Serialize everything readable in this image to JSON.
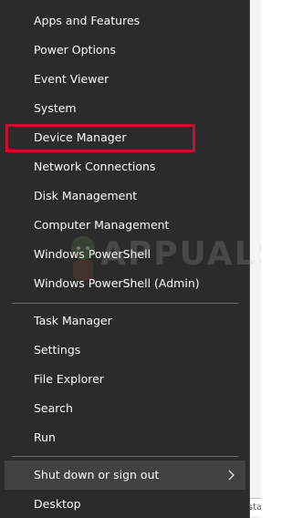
{
  "menu": {
    "items": [
      {
        "label": "Apps and Features"
      },
      {
        "label": "Power Options"
      },
      {
        "label": "Event Viewer"
      },
      {
        "label": "System"
      },
      {
        "label": "Device Manager"
      },
      {
        "label": "Network Connections"
      },
      {
        "label": "Disk Management"
      },
      {
        "label": "Computer Management"
      },
      {
        "label": "Windows PowerShell"
      },
      {
        "label": "Windows PowerShell (Admin)"
      },
      {
        "label": "Task Manager"
      },
      {
        "label": "Settings"
      },
      {
        "label": "File Explorer"
      },
      {
        "label": "Search"
      },
      {
        "label": "Run"
      },
      {
        "label": "Shut down or sign out",
        "submenu": true
      },
      {
        "label": "Desktop"
      }
    ]
  },
  "highlight": {
    "target": "Device Manager",
    "color": "#c8102e"
  },
  "watermark": {
    "text": "APPUALS"
  },
  "background_fragment": {
    "text": "state"
  },
  "colors": {
    "menu_bg": "#2b2b2b",
    "menu_text": "#ffffff",
    "hover_bg": "#414141",
    "separator": "#6b6b6b"
  }
}
